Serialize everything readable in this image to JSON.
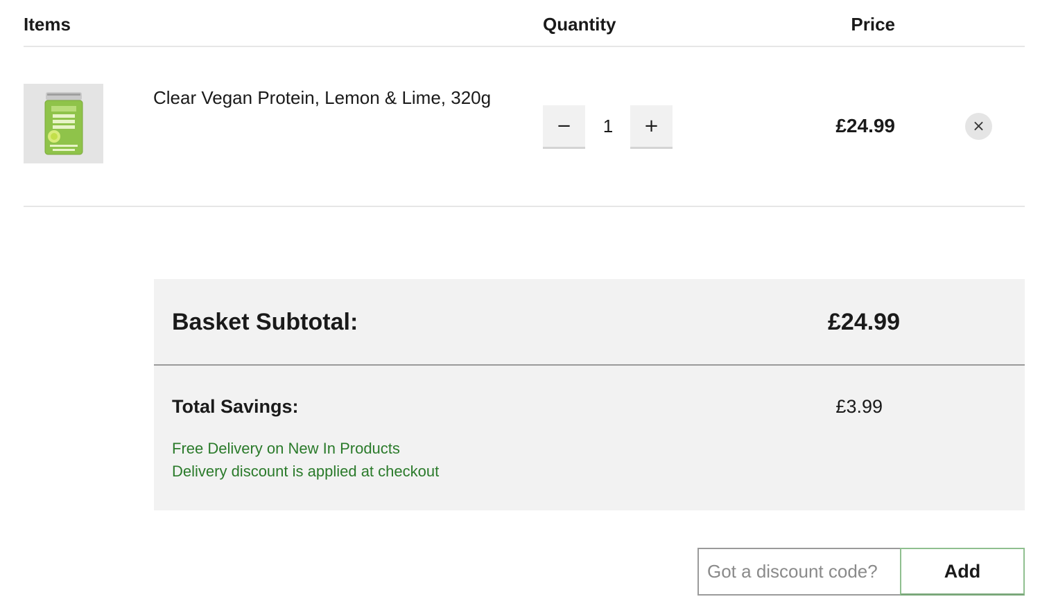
{
  "table_header": {
    "items": "Items",
    "quantity": "Quantity",
    "price": "Price"
  },
  "cart_items": [
    {
      "name": "Clear Vegan Protein, Lemon & Lime, 320g",
      "quantity": "1",
      "price": "£24.99",
      "thumbnail_icon": "protein-tub-image",
      "decrement_label": "−",
      "increment_label": "+",
      "remove_label": "×"
    }
  ],
  "summary": {
    "subtotal_label": "Basket Subtotal:",
    "subtotal_value": "£24.99",
    "savings_label": "Total Savings:",
    "savings_value": "£3.99",
    "promo_lines": [
      "Free Delivery on New In Products",
      "Delivery discount is applied at checkout"
    ]
  },
  "discount": {
    "placeholder": "Got a discount code?",
    "value": "",
    "button_label": "Add"
  },
  "colors": {
    "promo_text": "#2a7a2a",
    "summary_background": "#f2f2f2",
    "add_button_border": "#8fbf8f"
  }
}
